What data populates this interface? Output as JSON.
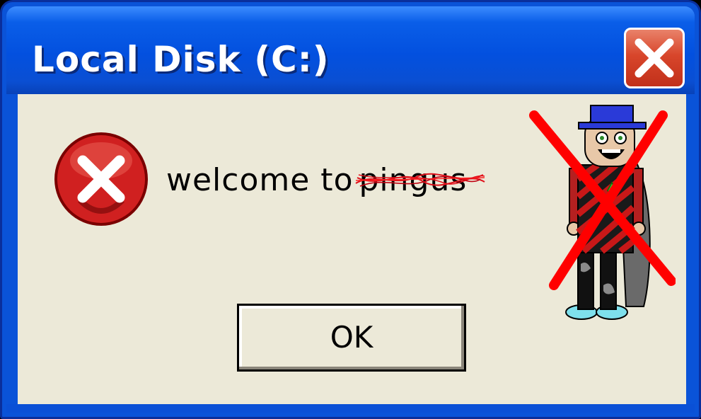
{
  "window": {
    "title": "Local Disk (C:)",
    "close_icon": "close-icon"
  },
  "dialog": {
    "icon": "error-icon",
    "message": "welcome to",
    "struck_word": "pingus",
    "ok_label": "OK"
  },
  "character": {
    "icon": "crossed-out-character",
    "cross_color": "#ff0000"
  },
  "colors": {
    "titlebar": "#0350df",
    "body": "#ece9d8",
    "close_button": "#d8462b",
    "scribble": "#e0101a"
  }
}
